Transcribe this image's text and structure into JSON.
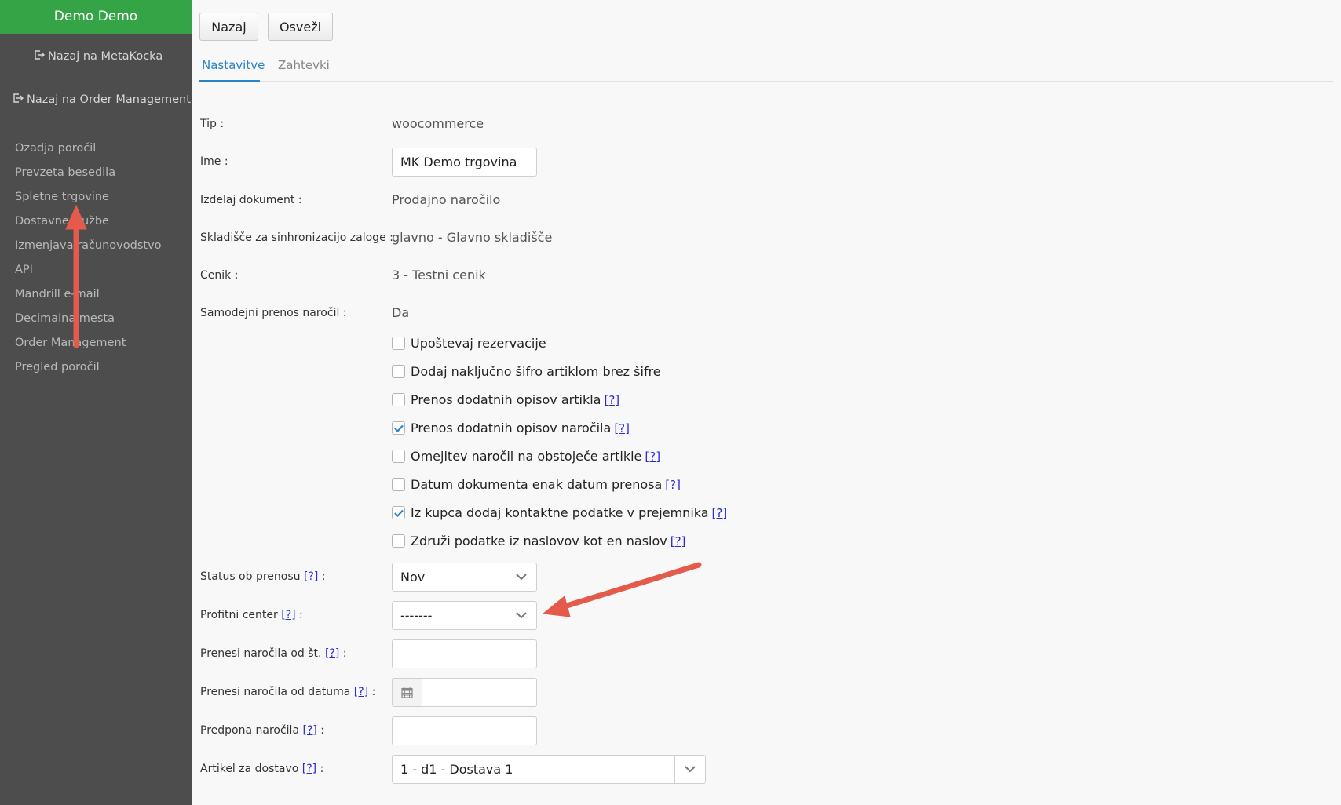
{
  "sidebar": {
    "header": "Demo Demo",
    "back_links": [
      {
        "label": "Nazaj na MetaKocka",
        "icon": "sign-out-icon"
      },
      {
        "label": "Nazaj na Order Management",
        "icon": "sign-out-icon"
      }
    ],
    "items": [
      {
        "label": "Ozadja poročil"
      },
      {
        "label": "Prevzeta besedila"
      },
      {
        "label": "Spletne trgovine"
      },
      {
        "label": "Dostavne službe"
      },
      {
        "label": "Izmenjava računovodstvo"
      },
      {
        "label": "API"
      },
      {
        "label": "Mandrill e-mail"
      },
      {
        "label": "Decimalna mesta"
      },
      {
        "label": "Order Management"
      },
      {
        "label": "Pregled poročil"
      }
    ]
  },
  "toolbar": {
    "back_label": "Nazaj",
    "refresh_label": "Osveži"
  },
  "tabs": [
    {
      "label": "Nastavitve",
      "active": true
    },
    {
      "label": "Zahtevki",
      "active": false
    }
  ],
  "form": {
    "help_link": "[?]",
    "type": {
      "label": "Tip :",
      "value": "woocommerce"
    },
    "name": {
      "label": "Ime :",
      "value": "MK Demo trgovina"
    },
    "document": {
      "label": "Izdelaj dokument :",
      "value": "Prodajno naročilo"
    },
    "warehouse": {
      "label": "Skladišče za sinhronizacijo zaloge :",
      "value": "glavno - Glavno skladišče"
    },
    "pricelist": {
      "label": "Cenik :",
      "value": "3 - Testni cenik"
    },
    "auto_transfer": {
      "label": "Samodejni prenos naročil :",
      "value": "Da"
    },
    "checkboxes": [
      {
        "label": "Upoštevaj rezervacije",
        "checked": false,
        "help": false
      },
      {
        "label": "Dodaj naključno šifro artiklom brez šifre",
        "checked": false,
        "help": false
      },
      {
        "label": "Prenos dodatnih opisov artikla",
        "checked": false,
        "help": true
      },
      {
        "label": "Prenos dodatnih opisov naročila",
        "checked": true,
        "help": true
      },
      {
        "label": "Omejitev naročil na obstoječe artikle",
        "checked": false,
        "help": true
      },
      {
        "label": "Datum dokumenta enak datum prenosa",
        "checked": false,
        "help": true
      },
      {
        "label": "Iz kupca dodaj kontaktne podatke v prejemnika",
        "checked": true,
        "help": true
      },
      {
        "label": "Združi podatke iz naslovov kot en naslov",
        "checked": false,
        "help": true
      }
    ],
    "status": {
      "label": "Status ob prenosu",
      "value": "Nov"
    },
    "profit_center": {
      "label": "Profitni center",
      "value": "-------"
    },
    "order_from_no": {
      "label": "Prenesi naročila od št.",
      "value": ""
    },
    "order_from_date": {
      "label": "Prenesi naročila od datuma",
      "value": ""
    },
    "order_prefix": {
      "label": "Predpona naročila",
      "value": ""
    },
    "delivery_item": {
      "label": "Artikel za dostavo",
      "value": "1 - d1 - Dostava 1"
    },
    "label_suffix": ":"
  },
  "colors": {
    "sidebar_bg": "#4d4d4d",
    "header_green": "#35a447",
    "tab_accent": "#2b83c7",
    "annotation_arrow": "#e45a4b",
    "checkbox_check": "#2b83c7"
  }
}
